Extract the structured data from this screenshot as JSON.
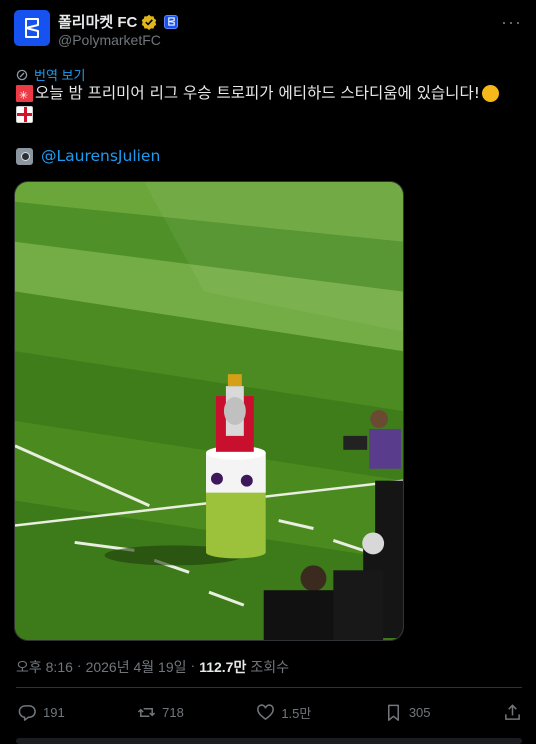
{
  "post": {
    "display_name": "폴리마켓 FC",
    "handle": "@PolymarketFC",
    "translate_label": "번역 보기",
    "text_line1": "오늘 밤 프리미어 리그 우승 트로피가 에티하드 스타디움에 있습니다!",
    "mention": "@LaurensJulien",
    "time": "오후 8:16",
    "dot": "·",
    "date": "2026년 4월 19일",
    "views_count": "112.7만",
    "views_label": "조회수"
  },
  "actions": {
    "replies": "191",
    "reposts": "718",
    "likes": "1.5만",
    "bookmarks": "305"
  },
  "colors": {
    "accent": "#1d9bf0",
    "background": "#000000",
    "brand": "#1652f0"
  },
  "icons": [
    "polymarket-logo-icon",
    "verified-gold-icon",
    "affiliate-badge-icon",
    "more-icon",
    "translate-icon",
    "reply-icon",
    "repost-icon",
    "like-icon",
    "bookmark-icon",
    "share-icon"
  ]
}
